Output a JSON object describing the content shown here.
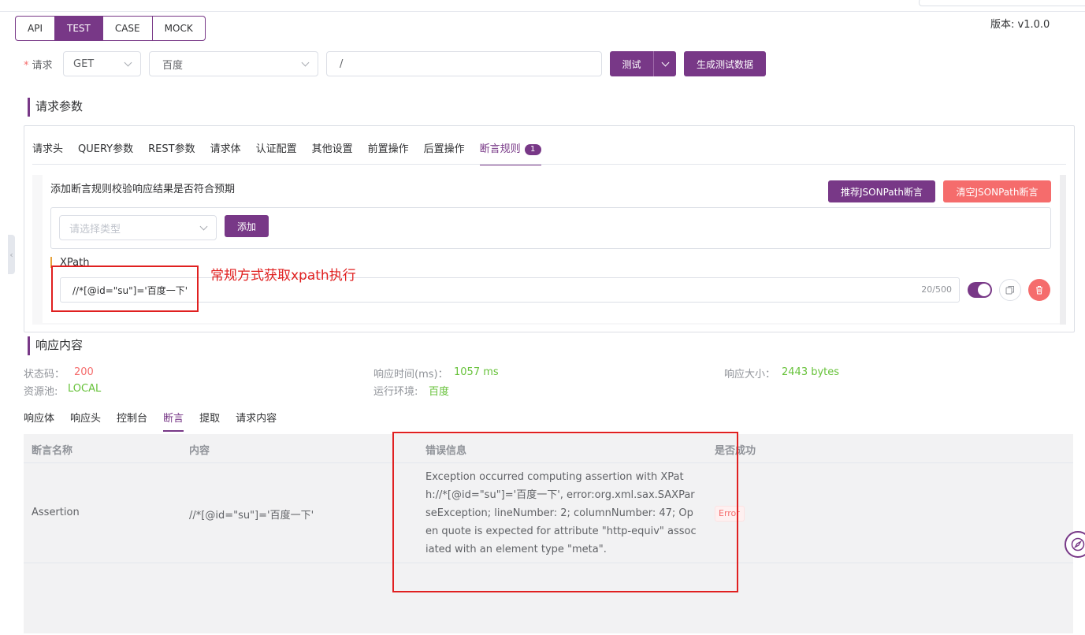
{
  "version": "版本: v1.0.0",
  "modes": [
    "API",
    "TEST",
    "CASE",
    "MOCK"
  ],
  "request": {
    "label": "请求",
    "method": "GET",
    "env": "百度",
    "path": "/",
    "test_label": "测试",
    "gen_label": "生成测试数据"
  },
  "params": {
    "title": "请求参数",
    "tabs": [
      "请求头",
      "QUERY参数",
      "REST参数",
      "请求体",
      "认证配置",
      "其他设置",
      "前置操作",
      "后置操作",
      "断言规则"
    ],
    "assert_badge": "1",
    "description": "添加断言规则校验响应结果是否符合预期",
    "json_btn": "推荐JSONPath断言",
    "clear_btn": "清空JSONPath断言",
    "type_placeholder": "请选择类型",
    "add_btn": "添加",
    "xpath_label": "XPath",
    "xpath_value": "//*[@id=\"su\"]='百度一下'",
    "counter": "20/500",
    "annotation": "常规方式获取xpath执行"
  },
  "response": {
    "title": "响应内容",
    "status_key": "状态码：",
    "status_val": "200",
    "time_key": "响应时间(ms)：",
    "time_val": "1057 ms",
    "size_key": "响应大小：",
    "size_val": "2443 bytes",
    "pool_key": "资源池:",
    "pool_val": "LOCAL",
    "env_key": "运行环境:",
    "env_val": "百度",
    "tabs": [
      "响应体",
      "响应头",
      "控制台",
      "断言",
      "提取",
      "请求内容"
    ],
    "columns": [
      "断言名称",
      "内容",
      "错误信息",
      "是否成功"
    ],
    "rows": [
      {
        "name": "Assertion",
        "content": "//*[@id=\"su\"]='百度一下'",
        "error": "Exception occurred computing assertion with XPath://*[@id=\"su\"]='百度一下', error:org.xml.sax.SAXParseException; lineNumber: 2; columnNumber: 47; Open quote is expected for attribute \"http-equiv\" associated with an element type \"meta\".",
        "status": "Error"
      }
    ]
  },
  "colors": {
    "accent": "#783887",
    "danger": "#f56c6c",
    "success": "#67c23a",
    "annotation": "#e02020"
  }
}
